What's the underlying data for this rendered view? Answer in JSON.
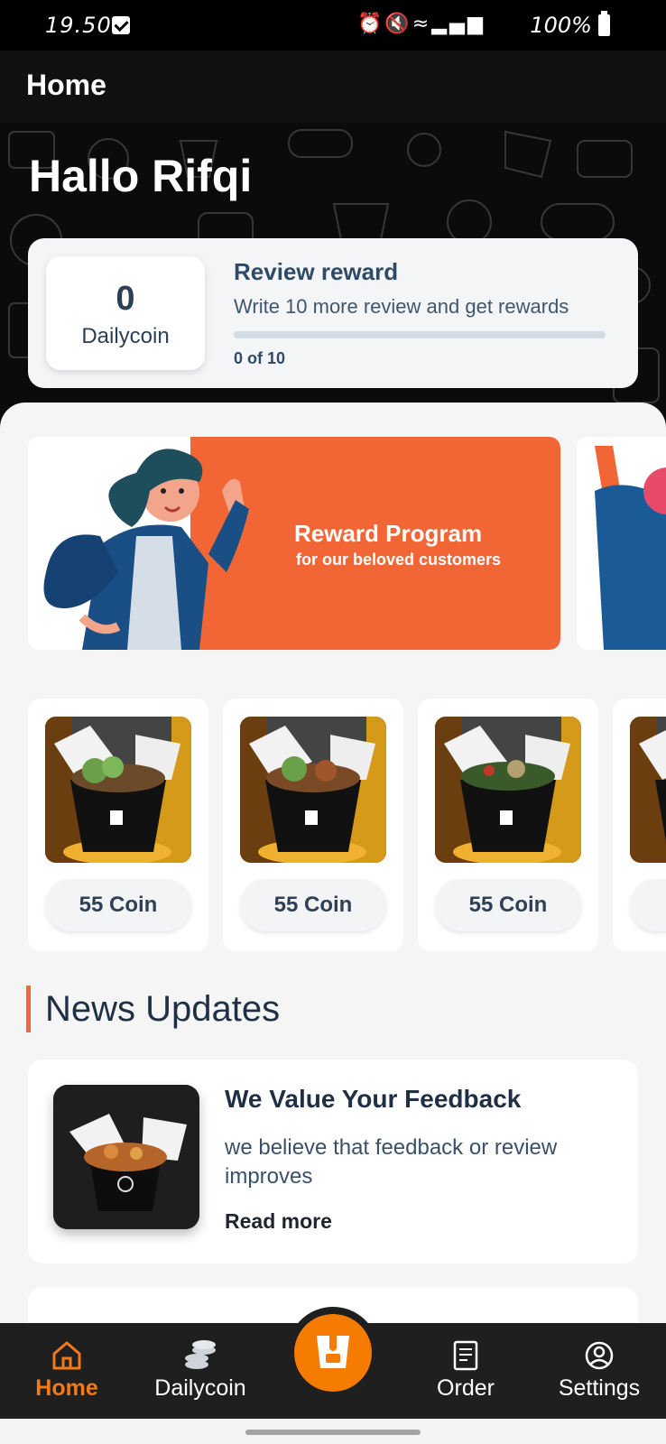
{
  "status_bar": {
    "time": "19.50",
    "battery": "100%"
  },
  "app_bar": {
    "title": "Home"
  },
  "hero": {
    "greeting": "Hallo Rifqi"
  },
  "reward": {
    "coin_value": "0",
    "coin_label": "Dailycoin",
    "title": "Review reward",
    "description": "Write 10 more review and get rewards",
    "progress_text": "0 of 10",
    "progress_fraction": 0
  },
  "banner": {
    "title": "Reward Program",
    "subtitle": "for our beloved customers"
  },
  "products": [
    {
      "price": "55 Coin"
    },
    {
      "price": "55 Coin"
    },
    {
      "price": "55 Coin"
    }
  ],
  "news": {
    "heading": "News Updates",
    "items": [
      {
        "title": "We Value Your Feedback",
        "description": "we believe that feedback or review improves",
        "link": "Read more"
      }
    ]
  },
  "bottom_nav": {
    "items": [
      {
        "label": "Home",
        "icon": "home-icon",
        "active": true
      },
      {
        "label": "Dailycoin",
        "icon": "coins-icon",
        "active": false
      },
      {
        "label": "Order",
        "icon": "receipt-icon",
        "active": false
      },
      {
        "label": "Settings",
        "icon": "profile-icon",
        "active": false
      }
    ],
    "center_icon": "dailybox-logo-icon"
  },
  "colors": {
    "accent": "#f26a30",
    "nav_active": "#f27a1a",
    "dark_bg": "#111111",
    "text_navy": "#1f3044"
  }
}
